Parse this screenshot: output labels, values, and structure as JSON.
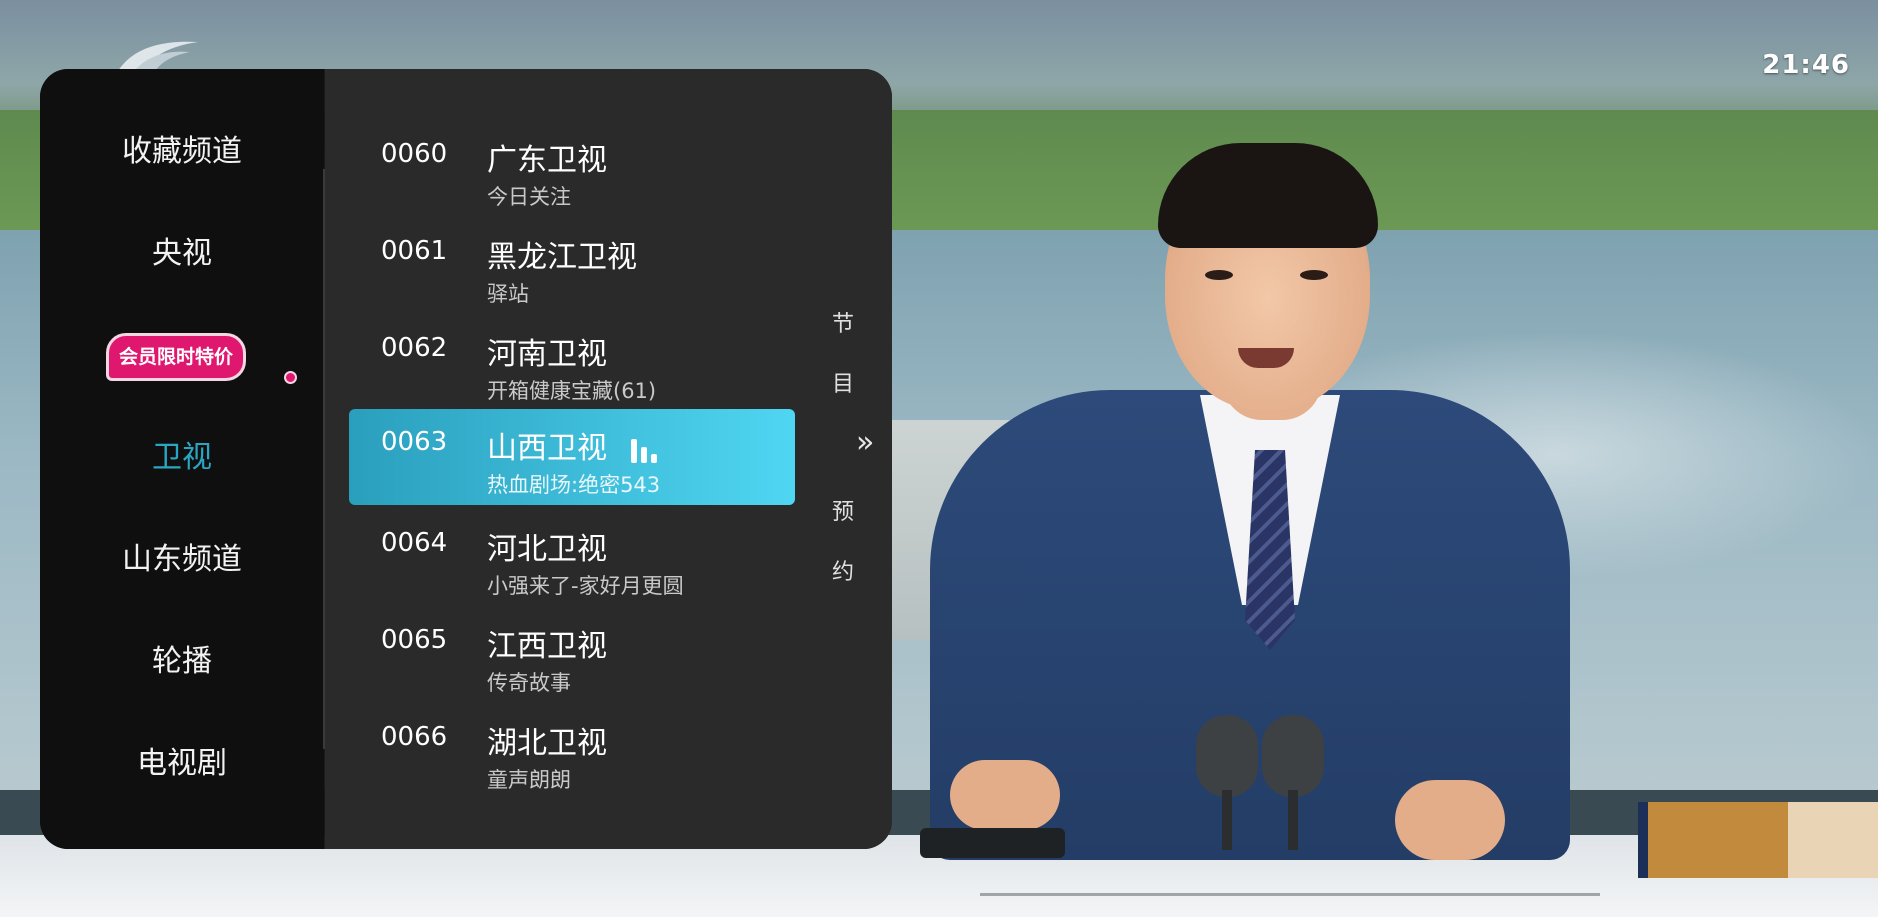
{
  "clock": "21:46",
  "categories": [
    {
      "label": "收藏频道",
      "active": false
    },
    {
      "label": "央视",
      "active": false
    },
    {
      "label": "卫视",
      "active": true
    },
    {
      "label": "山东频道",
      "active": false
    },
    {
      "label": "轮播",
      "active": false
    },
    {
      "label": "电视剧",
      "active": false
    }
  ],
  "promo_badge": "会员限时特价",
  "channels": [
    {
      "number": "0060",
      "name": "广东卫视",
      "program": "今日关注"
    },
    {
      "number": "0061",
      "name": "黑龙江卫视",
      "program": "驿站"
    },
    {
      "number": "0062",
      "name": "河南卫视",
      "program": "开箱健康宝藏(61)"
    },
    {
      "number": "0063",
      "name": "山西卫视",
      "program": "热血剧场:绝密543",
      "playing": true
    },
    {
      "number": "0064",
      "name": "河北卫视",
      "program": "小强来了-家好月更圆"
    },
    {
      "number": "0065",
      "name": "江西卫视",
      "program": "传奇故事"
    },
    {
      "number": "0066",
      "name": "湖北卫视",
      "program": "童声朗朗"
    }
  ],
  "side_tabs": {
    "epg": [
      "节",
      "目"
    ],
    "reserve": [
      "预",
      "约"
    ],
    "expand": "»"
  },
  "colors": {
    "accent": "#2aa6c3",
    "highlight_start": "#2a9fbd",
    "highlight_end": "#4fd6f2",
    "promo": "#e0176f"
  }
}
